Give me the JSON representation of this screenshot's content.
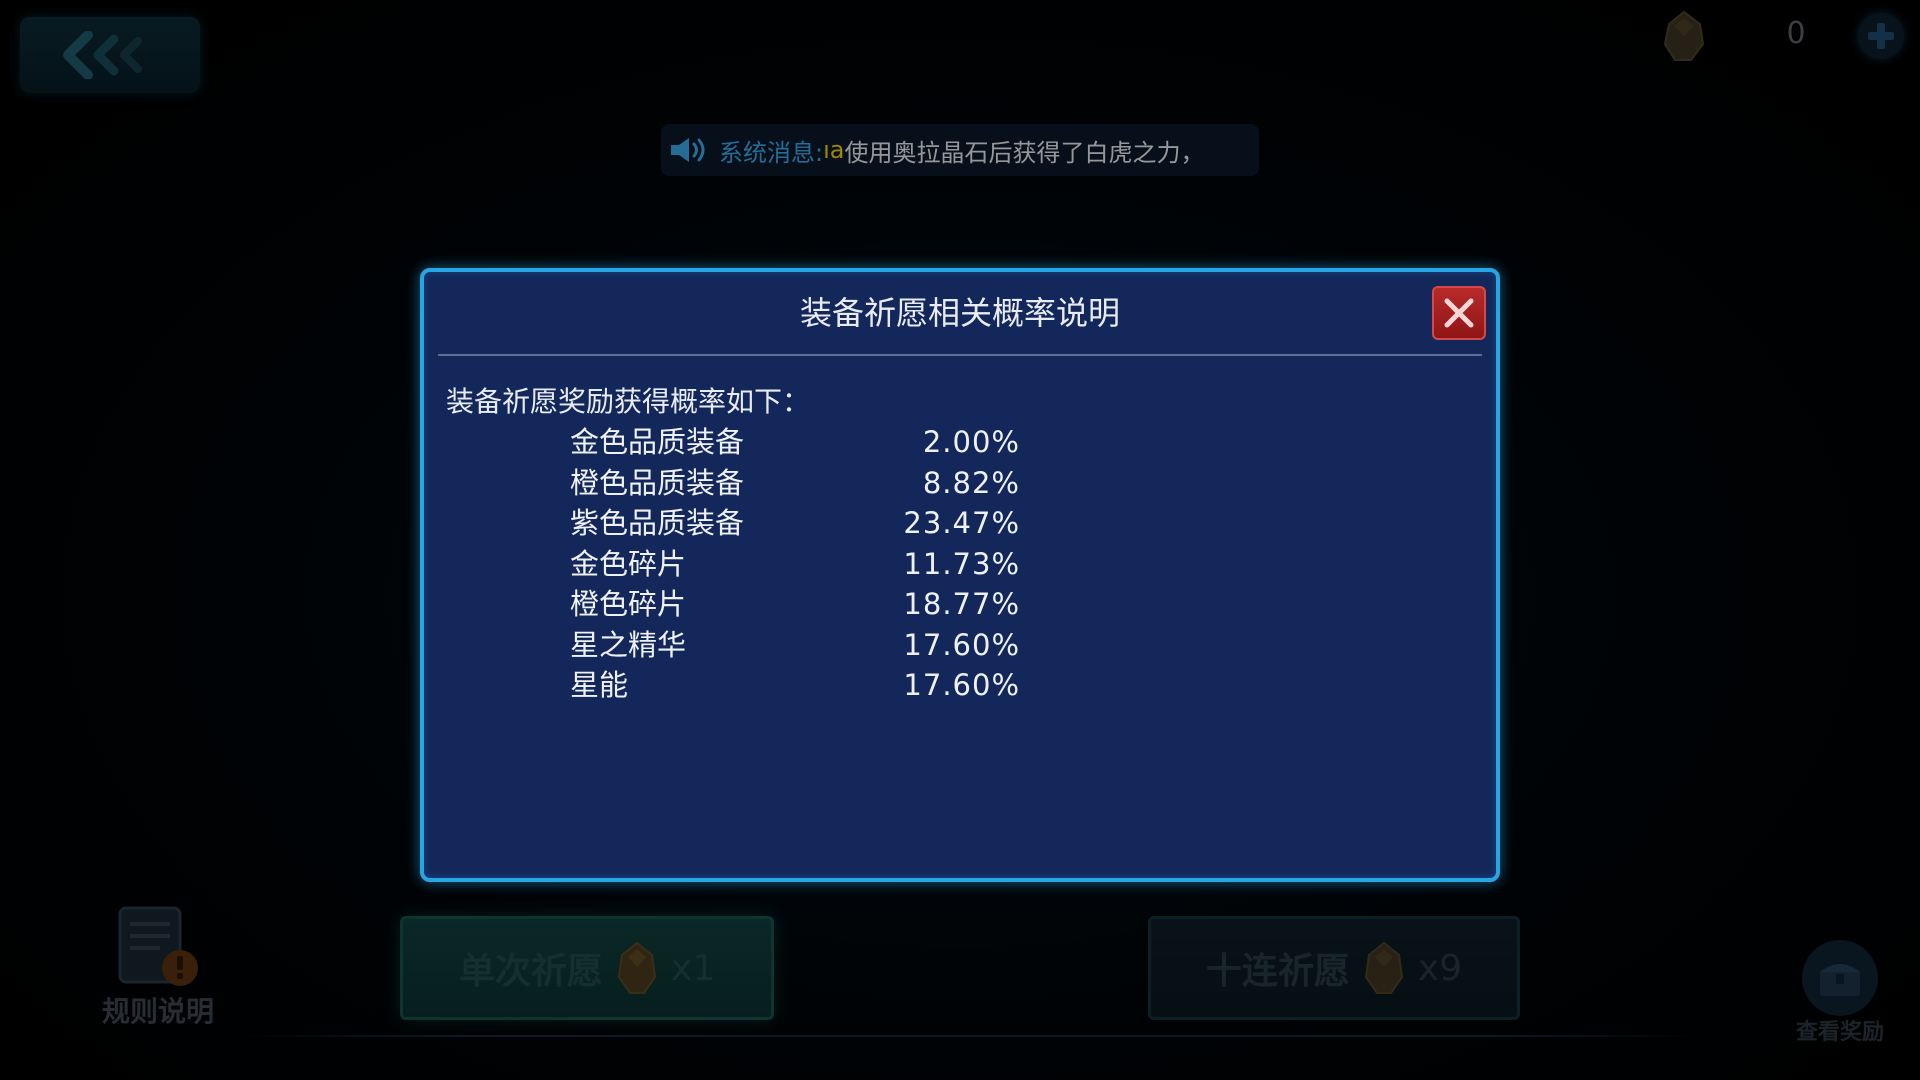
{
  "top_bar": {
    "back_icon": "triple-chevron-left-icon",
    "currency_icon": "crystal-gem-icon",
    "currency_count": "0",
    "add_icon": "plus-icon"
  },
  "system_message": {
    "icon": "speaker-icon",
    "prefix": "系统消息:",
    "player_name": "ıa",
    "text": "使用奥拉晶石后获得了白虎之力，"
  },
  "dialog": {
    "title": "装备祈愿相关概率说明",
    "close_icon": "close-x-icon",
    "intro": "装备祈愿奖励获得概率如下：",
    "rows": [
      {
        "name": "金色品质装备",
        "value": "2.00%"
      },
      {
        "name": "橙色品质装备",
        "value": "8.82%"
      },
      {
        "name": "紫色品质装备",
        "value": "23.47%"
      },
      {
        "name": "金色碎片",
        "value": "11.73%"
      },
      {
        "name": "橙色碎片",
        "value": "18.77%"
      },
      {
        "name": "星之精华",
        "value": "17.60%"
      },
      {
        "name": "星能",
        "value": "17.60%"
      }
    ]
  },
  "bottom": {
    "rules_label": "规则说明",
    "single_wish_label": "单次祈愿",
    "single_wish_cost": "x1",
    "ten_wish_label": "十连祈愿",
    "ten_wish_cost": "x9",
    "view_rewards_label": "查看奖励"
  },
  "colors": {
    "dialog_bg": "#13275a",
    "dialog_border": "#27a6e6",
    "close_red": "#b82a2a",
    "system_prefix": "#3aa8e6",
    "player_name": "#f5d000"
  }
}
